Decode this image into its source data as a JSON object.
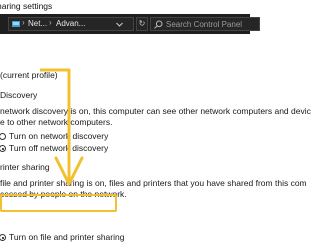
{
  "window": {
    "title": "haring settings"
  },
  "address_bar": {
    "crumbs": [
      "Net...",
      "Advan..."
    ],
    "search_placeholder": "Search Control Panel"
  },
  "content": {
    "profile_heading": "(current profile)",
    "network_discovery": {
      "heading": "Discovery",
      "description_lines": [
        "network discovery is on, this computer can see other network computers and devic",
        "e to other network computers."
      ],
      "options": [
        {
          "label": "Turn on network discovery",
          "selected": false
        },
        {
          "label": "Turn off network discovery",
          "selected": true
        }
      ]
    },
    "printer_sharing": {
      "heading": "rinter sharing",
      "description_lines": [
        "file and printer sharing is on, files and printers that you have shared from this com",
        "cessed by people on the network."
      ],
      "options": [
        {
          "label": "Turn on file and printer sharing",
          "selected": true
        }
      ]
    }
  },
  "annotation": {
    "highlight_color": "#f2c12e"
  }
}
